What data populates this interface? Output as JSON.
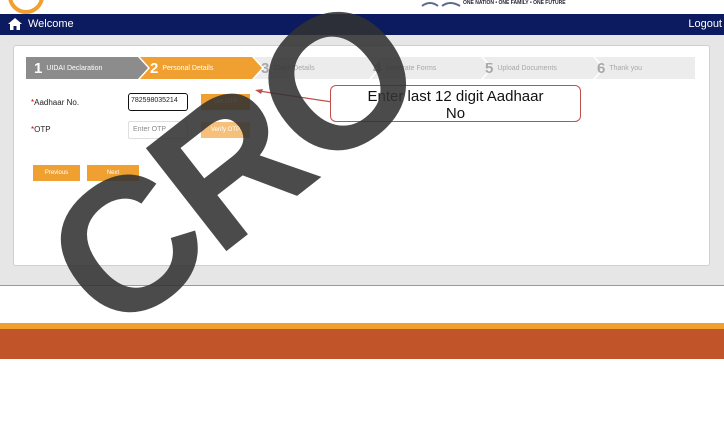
{
  "header": {
    "tagline": "ONE NATION • ONE FAMILY • ONE FUTURE",
    "welcome": "Welcome",
    "logout": "Logout"
  },
  "stepper": [
    {
      "num": "1",
      "label": "UIDAI Declaration",
      "state": "done"
    },
    {
      "num": "2",
      "label": "Personal Details",
      "state": "active"
    },
    {
      "num": "3",
      "label": "Claim Details",
      "state": "pending"
    },
    {
      "num": "4",
      "label": "Generate Forms",
      "state": "pending"
    },
    {
      "num": "5",
      "label": "Upload Documents",
      "state": "pending"
    },
    {
      "num": "6",
      "label": "Thank you",
      "state": "pending"
    }
  ],
  "form": {
    "aadhaar_label": "Aadhaar No.",
    "aadhaar_value": "782598035214",
    "otp_label": "OTP",
    "otp_placeholder": "Enter OTP",
    "get_otp": "Get OTP",
    "verify_otp": "Verify OTP",
    "previous": "Previous",
    "next": "Next"
  },
  "annotation": {
    "line1": "Enter last 12 digit Aadhaar",
    "line2": "No"
  },
  "watermark": "CRO",
  "colors": {
    "navbar": "#0c1b60",
    "accent": "#f0a030",
    "done_step": "#8c8c8c",
    "pending_step": "#ececec",
    "callout_border": "#c0504d",
    "footer": "#c2542a"
  }
}
